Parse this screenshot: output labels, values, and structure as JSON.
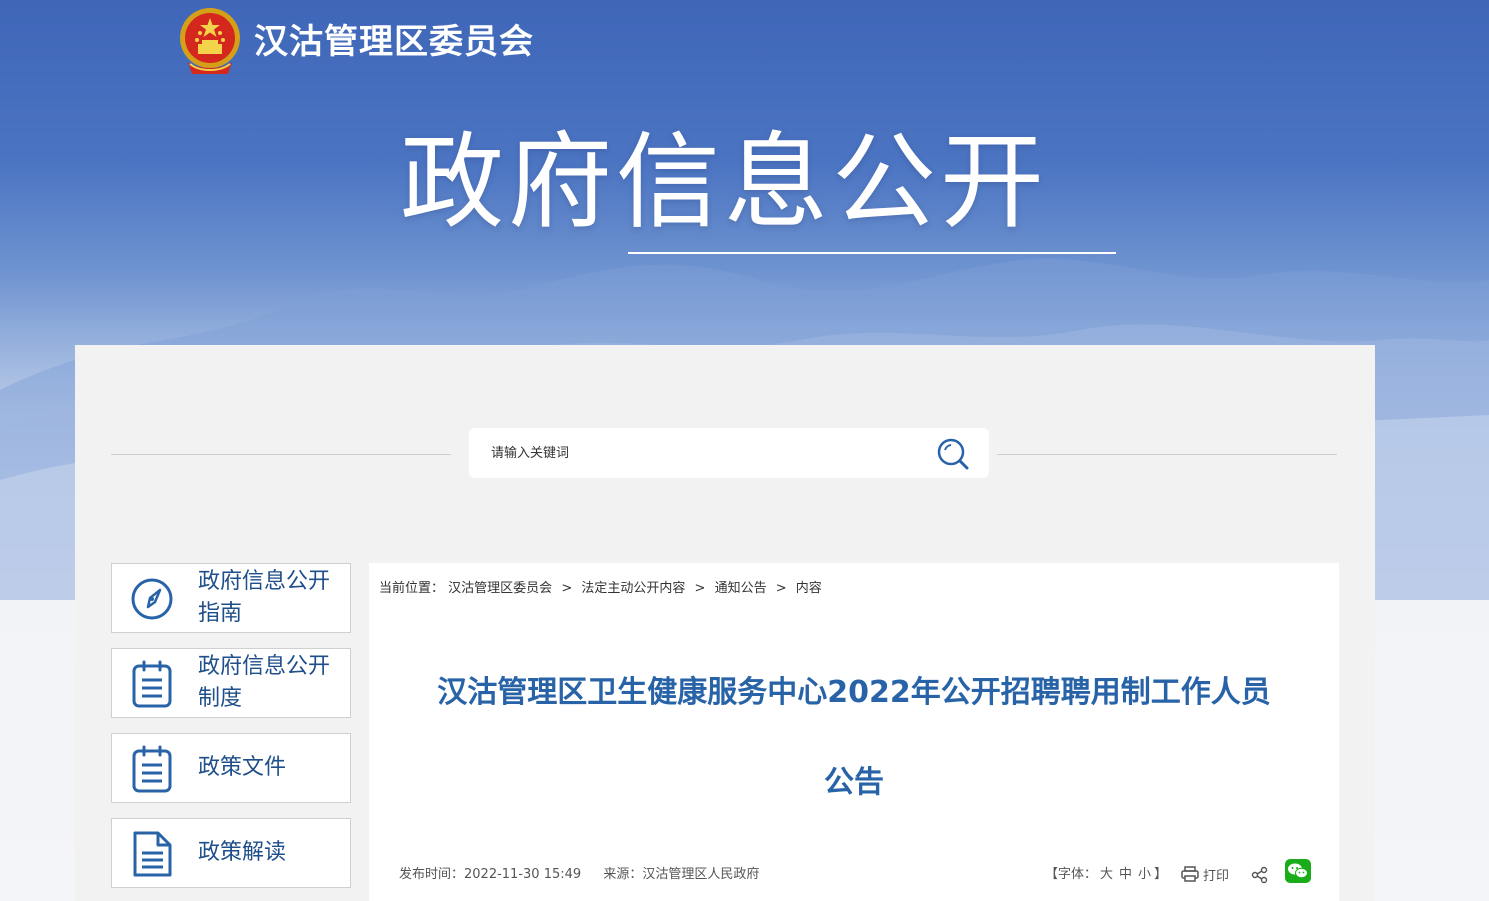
{
  "header": {
    "site_name": "汉沽管理区委员会",
    "hero_title": "政府信息公开"
  },
  "search": {
    "placeholder": "请输入关键词"
  },
  "sidebar": {
    "items": [
      {
        "label": "政府信息公开指南",
        "icon": "compass-icon"
      },
      {
        "label": "政府信息公开制度",
        "icon": "clipboard-icon"
      },
      {
        "label": "政策文件",
        "icon": "clipboard-icon"
      },
      {
        "label": "政策解读",
        "icon": "document-icon"
      }
    ]
  },
  "breadcrumb": {
    "prefix": "当前位置：",
    "items": [
      "汉沽管理区委员会",
      "法定主动公开内容",
      "通知公告",
      "内容"
    ],
    "separator": ">"
  },
  "article": {
    "title_line1": "汉沽管理区卫生健康服务中心2022年公开招聘聘用制工作人员",
    "title_line2": "公告",
    "publish_label": "发布时间：",
    "publish_time": "2022-11-30 15:49",
    "source_label": "来源：",
    "source": "汉沽管理区人民政府"
  },
  "tools": {
    "font_label": "【字体：",
    "font_large": "大",
    "font_medium": "中",
    "font_small": "小",
    "font_close": "】",
    "print_label": "打印"
  },
  "colors": {
    "brand_blue": "#2863a8",
    "banner_blue": "#3f66b8",
    "wechat_green": "#1aad19"
  }
}
